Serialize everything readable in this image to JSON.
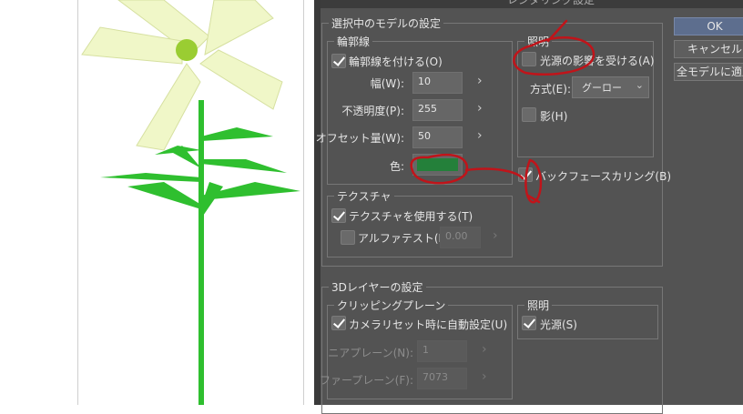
{
  "dialog": {
    "title": "レンダリング設定",
    "buttons": {
      "ok": "OK",
      "cancel": "キャンセル",
      "apply_all": "全モデルに適用"
    },
    "model_settings": {
      "label": "選択中のモデルの設定",
      "outline": {
        "label": "輪郭線",
        "enable_label": "輪郭線を付ける(O)",
        "enable_checked": true,
        "width_label": "幅(W):",
        "width_value": "10",
        "opacity_label": "不透明度(P):",
        "opacity_value": "255",
        "offset_label": "オフセット量(W):",
        "offset_value": "50",
        "color_label": "色:",
        "color_value": "#24803a"
      },
      "lighting": {
        "label": "照明",
        "affected_label": "光源の影響を受ける(A)",
        "affected_checked": false,
        "method_label": "方式(E):",
        "method_value": "グーロー",
        "shadow_label": "影(H)",
        "shadow_checked": false
      },
      "backface_label": "バックフェースカリング(B)",
      "backface_checked": true,
      "texture": {
        "label": "テクスチャ",
        "use_label": "テクスチャを使用する(T)",
        "use_checked": true,
        "alpha_label": "アルファテスト(L)",
        "alpha_checked": false,
        "alpha_value": "0.00"
      }
    },
    "layer_settings": {
      "label": "3Dレイヤーの設定",
      "clipping": {
        "label": "クリッピングプレーン",
        "auto_label": "カメラリセット時に自動設定(U)",
        "auto_checked": true,
        "near_label": "ニアプレーン(N):",
        "near_value": "1",
        "far_label": "ファープレーン(F):",
        "far_value": "7073"
      },
      "lighting": {
        "label": "照明",
        "light_label": "光源(S)",
        "light_checked": true
      }
    }
  },
  "colors": {
    "annotation": "#c0141a",
    "dialog_bg": "#535353",
    "ok_button": "#5d6e8e"
  }
}
